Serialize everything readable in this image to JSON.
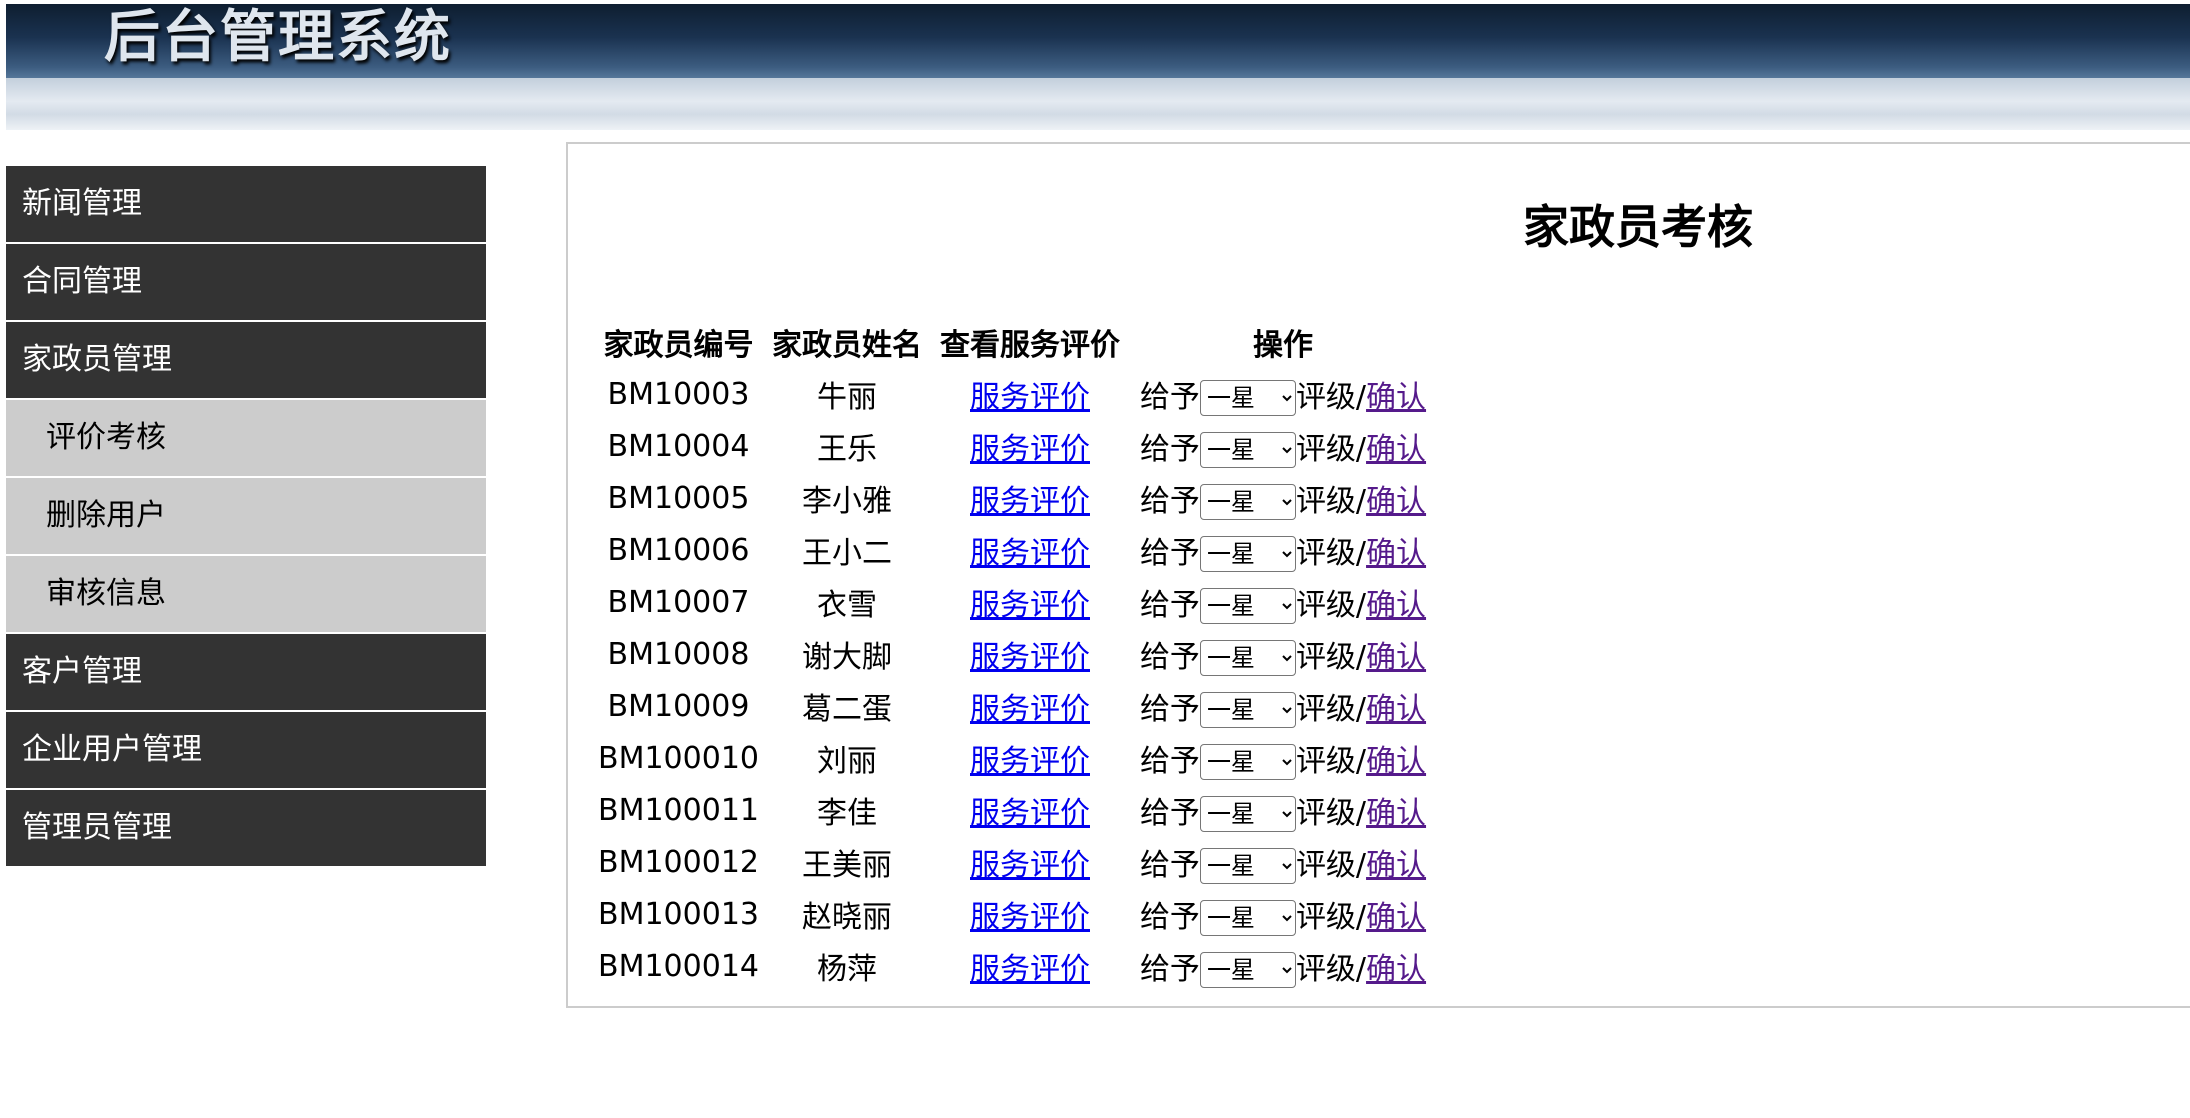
{
  "header": {
    "app_title": "后台管理系统"
  },
  "sidebar": {
    "items": [
      {
        "label": "新闻管理",
        "level": "main"
      },
      {
        "label": "合同管理",
        "level": "main"
      },
      {
        "label": "家政员管理",
        "level": "main"
      },
      {
        "label": "评价考核",
        "level": "sub"
      },
      {
        "label": "删除用户",
        "level": "sub"
      },
      {
        "label": "审核信息",
        "level": "sub"
      },
      {
        "label": "客户管理",
        "level": "main"
      },
      {
        "label": "企业用户管理",
        "level": "main"
      },
      {
        "label": "管理员管理",
        "level": "main"
      }
    ]
  },
  "main": {
    "title": "家政员考核",
    "table": {
      "headers": [
        "家政员编号",
        "家政员姓名",
        "查看服务评价",
        "操作"
      ],
      "rows": [
        {
          "id": "BM10003",
          "name": "牛丽",
          "review_link": "服务评价",
          "give_label": "给予",
          "rating": "一星",
          "rate_label": "评级/",
          "confirm": "确认"
        },
        {
          "id": "BM10004",
          "name": "王乐",
          "review_link": "服务评价",
          "give_label": "给予",
          "rating": "一星",
          "rate_label": "评级/",
          "confirm": "确认"
        },
        {
          "id": "BM10005",
          "name": "李小雅",
          "review_link": "服务评价",
          "give_label": "给予",
          "rating": "一星",
          "rate_label": "评级/",
          "confirm": "确认"
        },
        {
          "id": "BM10006",
          "name": "王小二",
          "review_link": "服务评价",
          "give_label": "给予",
          "rating": "一星",
          "rate_label": "评级/",
          "confirm": "确认"
        },
        {
          "id": "BM10007",
          "name": "衣雪",
          "review_link": "服务评价",
          "give_label": "给予",
          "rating": "一星",
          "rate_label": "评级/",
          "confirm": "确认"
        },
        {
          "id": "BM10008",
          "name": "谢大脚",
          "review_link": "服务评价",
          "give_label": "给予",
          "rating": "一星",
          "rate_label": "评级/",
          "confirm": "确认"
        },
        {
          "id": "BM10009",
          "name": "葛二蛋",
          "review_link": "服务评价",
          "give_label": "给予",
          "rating": "一星",
          "rate_label": "评级/",
          "confirm": "确认"
        },
        {
          "id": "BM100010",
          "name": "刘丽",
          "review_link": "服务评价",
          "give_label": "给予",
          "rating": "一星",
          "rate_label": "评级/",
          "confirm": "确认"
        },
        {
          "id": "BM100011",
          "name": "李佳",
          "review_link": "服务评价",
          "give_label": "给予",
          "rating": "一星",
          "rate_label": "评级/",
          "confirm": "确认"
        },
        {
          "id": "BM100012",
          "name": "王美丽",
          "review_link": "服务评价",
          "give_label": "给予",
          "rating": "一星",
          "rate_label": "评级/",
          "confirm": "确认"
        },
        {
          "id": "BM100013",
          "name": "赵晓丽",
          "review_link": "服务评价",
          "give_label": "给予",
          "rating": "一星",
          "rate_label": "评级/",
          "confirm": "确认"
        },
        {
          "id": "BM100014",
          "name": "杨萍",
          "review_link": "服务评价",
          "give_label": "给予",
          "rating": "一星",
          "rate_label": "评级/",
          "confirm": "确认"
        }
      ]
    }
  },
  "colors": {
    "header_dark": "#0e1e30",
    "header_light": "#55779a",
    "menu_main_bg": "#333333",
    "menu_sub_bg": "#cccccc",
    "link_unvisited": "#0000ee",
    "link_visited": "#551a8b"
  }
}
